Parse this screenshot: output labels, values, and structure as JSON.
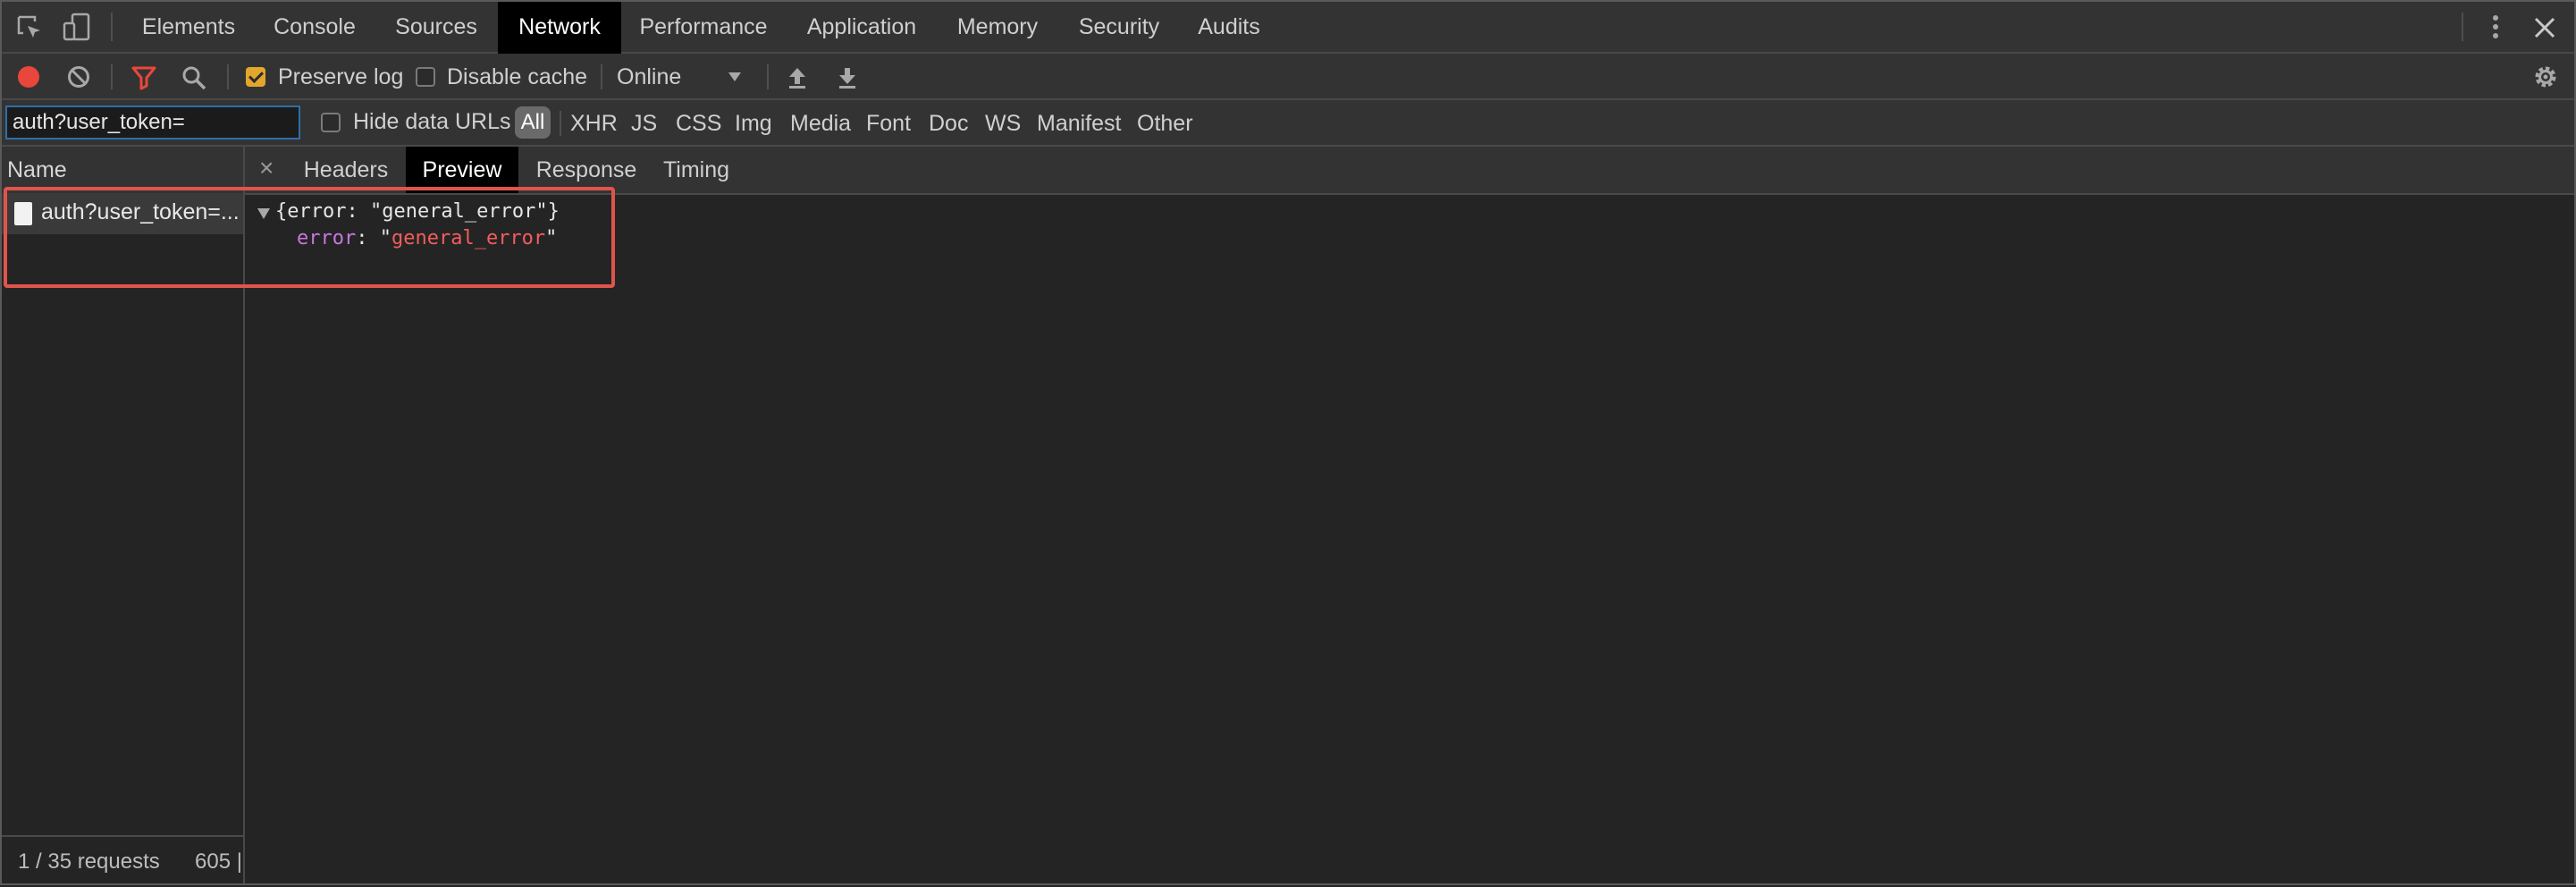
{
  "tabs": [
    "Elements",
    "Console",
    "Sources",
    "Network",
    "Performance",
    "Application",
    "Memory",
    "Security",
    "Audits"
  ],
  "active_tab": "Network",
  "toolbar": {
    "preserve_log_label": "Preserve log",
    "preserve_log_checked": true,
    "disable_cache_label": "Disable cache",
    "disable_cache_checked": false,
    "throttle_value": "Online"
  },
  "filter": {
    "value": "auth?user_token=",
    "hide_data_urls_label": "Hide data URLs",
    "types": [
      "All",
      "XHR",
      "JS",
      "CSS",
      "Img",
      "Media",
      "Font",
      "Doc",
      "WS",
      "Manifest",
      "Other"
    ],
    "active_type": "All"
  },
  "requests": {
    "column_header": "Name",
    "rows": [
      {
        "name": "auth?user_token=..."
      }
    ],
    "status_requests": "1 / 35 requests",
    "status_transferred": "605 |"
  },
  "detail": {
    "close_glyph": "×",
    "tabs": [
      "Headers",
      "Preview",
      "Response",
      "Timing"
    ],
    "active_tab": "Preview",
    "preview": {
      "summary": "{error: \"general_error\"}",
      "key": "error",
      "value": "general_error"
    }
  },
  "colors": {
    "record": "#e9473b",
    "filter_active": "#e9473b",
    "json_key": "#c678dd",
    "json_string": "#f25d5d",
    "highlight_box": "#e0554b",
    "checkbox_on": "#e3a62c"
  }
}
